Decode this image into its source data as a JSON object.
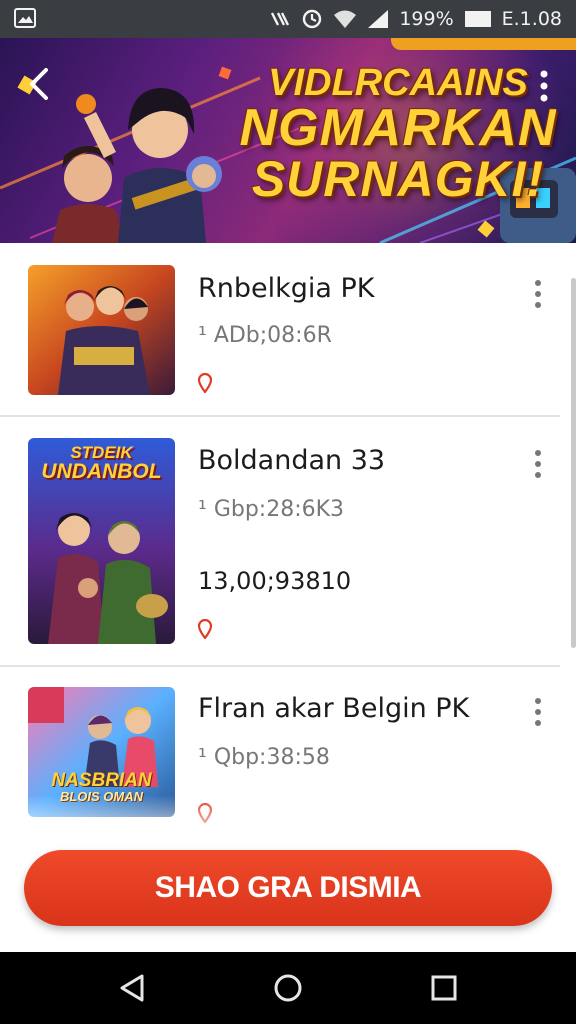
{
  "status_bar": {
    "battery_percent": "199%",
    "time": "E.1.08",
    "icons": [
      "gallery-icon",
      "nfc-icon",
      "data-saver-icon",
      "wifi-icon",
      "signal-icon",
      "battery-icon"
    ]
  },
  "banner": {
    "title_line1": "VIDLRCAAINS",
    "title_line2": "NGMARKAN",
    "title_line3": "SURNAGKI!",
    "accent_color": "#ffd23a"
  },
  "items": [
    {
      "title": "Rnbelkgia PK",
      "meta": "¹ ADb;08:6R",
      "count": ""
    },
    {
      "title": "Boldandan 33",
      "meta": "¹ Gbp:28:6K3",
      "count": "13,00;93810",
      "thumb_line1": "STDEIK",
      "thumb_line2": "UNDANBOL"
    },
    {
      "title": "Flran akar Belgin PK",
      "meta": "¹ Qbp:38:58",
      "count": "",
      "thumb_line1": "NASBRIAN",
      "thumb_line2": "BLOIS OMAN"
    }
  ],
  "cta": {
    "label": "SHAO GRA DISMIA",
    "color": "#e53e22"
  },
  "nav": {
    "icons": [
      "back-icon",
      "home-icon",
      "recents-icon"
    ]
  }
}
